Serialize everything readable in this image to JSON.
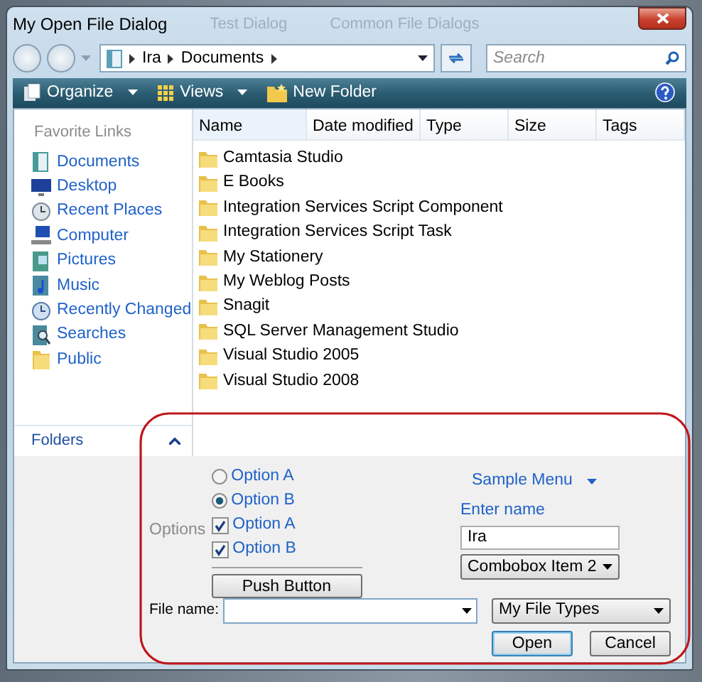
{
  "window": {
    "title": "My Open File Dialog",
    "background_titles": [
      "Test Dialog",
      "Common File Dialogs"
    ]
  },
  "address_bar": {
    "breadcrumbs": [
      "Ira",
      "Documents"
    ]
  },
  "search": {
    "placeholder": "Search"
  },
  "toolbar": [
    {
      "label": "Organize",
      "kind": "menu"
    },
    {
      "label": "Views",
      "kind": "views"
    },
    {
      "label": "New Folder",
      "kind": "folder"
    }
  ],
  "favorite_links": {
    "heading": "Favorite Links",
    "items": [
      {
        "label": "Documents",
        "kind": "documents"
      },
      {
        "label": "Desktop",
        "kind": "desktop"
      },
      {
        "label": "Recent Places",
        "kind": "recent"
      },
      {
        "label": "Computer",
        "kind": "computer"
      },
      {
        "label": "Pictures",
        "kind": "pictures"
      },
      {
        "label": "Music",
        "kind": "music"
      },
      {
        "label": "Recently Changed",
        "kind": "changed"
      },
      {
        "label": "Searches",
        "kind": "searches"
      },
      {
        "label": "Public",
        "kind": "folder"
      }
    ]
  },
  "folders_bar": {
    "label": "Folders"
  },
  "file_list": {
    "columns": [
      "Name",
      "Date modified",
      "Type",
      "Size",
      "Tags"
    ],
    "rows": [
      "Camtasia Studio",
      "E Books",
      "Integration Services Script Component",
      "Integration Services Script Task",
      "My Stationery",
      "My Weblog Posts",
      "Snagit",
      "SQL Server Management Studio",
      "Visual Studio 2005",
      "Visual Studio 2008"
    ]
  },
  "custom_controls": {
    "options_label": "Options",
    "items": [
      {
        "kind": "radio",
        "label": "Option A",
        "checked": false
      },
      {
        "kind": "radio",
        "label": "Option B",
        "checked": true
      },
      {
        "kind": "checkbox",
        "label": "Option A",
        "checked": true
      },
      {
        "kind": "checkbox",
        "label": "Option B",
        "checked": true
      }
    ],
    "push_button": "Push Button",
    "menu": {
      "label": "Sample Menu"
    },
    "name_field": {
      "label": "Enter name",
      "value": "Ira"
    },
    "combobox": {
      "value": "Combobox Item 2"
    }
  },
  "file_name": {
    "label": "File name:"
  },
  "file_type": {
    "value": "My File Types"
  },
  "buttons": [
    {
      "label": "Open",
      "default": true
    },
    {
      "label": "Cancel",
      "default": false
    }
  ]
}
